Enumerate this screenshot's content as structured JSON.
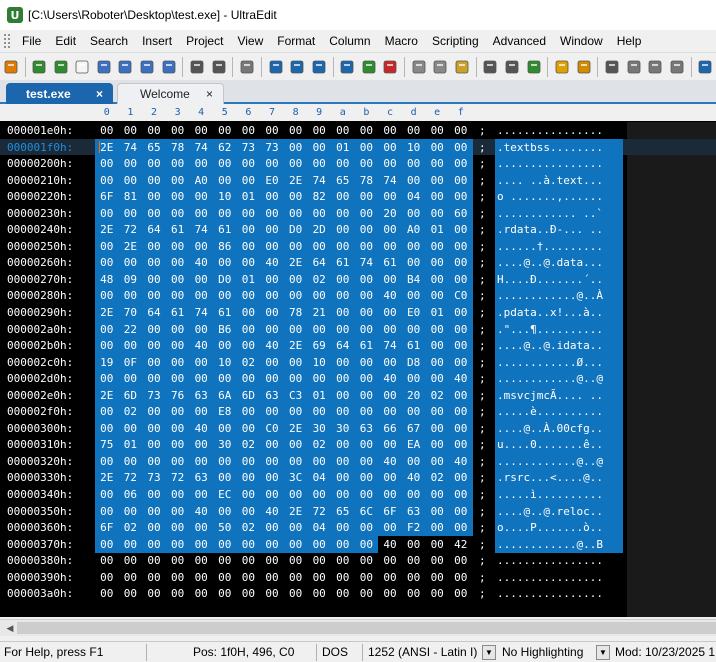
{
  "window": {
    "title": "[C:\\Users\\Roboter\\Desktop\\test.exe] - UltraEdit",
    "icon_letter": "U"
  },
  "menu": [
    "File",
    "Edit",
    "Search",
    "Insert",
    "Project",
    "View",
    "Format",
    "Column",
    "Macro",
    "Scripting",
    "Advanced",
    "Window",
    "Help"
  ],
  "toolbar_icons": [
    "open-file-icon",
    "back-icon",
    "forward-icon",
    "new-file-icon",
    "open-folder-icon",
    "folder-icon",
    "save-icon",
    "save-all-icon",
    "print-icon",
    "print-preview-icon",
    "page-icon",
    "hex-mode-icon",
    "column-mode-icon",
    "word-wrap-icon",
    "compare-icon",
    "check-icon",
    "stop-icon",
    "cut-icon",
    "copy-icon",
    "paste-icon",
    "find-icon",
    "replace-icon",
    "find-in-files-icon",
    "macro-icon",
    "list-icon",
    "bookmark-icon",
    "window-icon",
    "tile-icon",
    "cascade-icon",
    "web-icon"
  ],
  "tabs": [
    {
      "label": "test.exe",
      "close": "×",
      "active": true
    },
    {
      "label": "Welcome",
      "close": "×",
      "active": false
    }
  ],
  "hex_header": [
    "0",
    "1",
    "2",
    "3",
    "4",
    "5",
    "6",
    "7",
    "8",
    "9",
    "a",
    "b",
    "c",
    "d",
    "e",
    "f"
  ],
  "rows": [
    {
      "addr": "000001e0h:",
      "bytes": [
        "00",
        "00",
        "00",
        "00",
        "00",
        "00",
        "00",
        "00",
        "00",
        "00",
        "00",
        "00",
        "00",
        "00",
        "00",
        "00"
      ],
      "ascii": "................"
    },
    {
      "addr": "000001f0h:",
      "bytes": [
        "2E",
        "74",
        "65",
        "78",
        "74",
        "62",
        "73",
        "73",
        "00",
        "00",
        "01",
        "00",
        "00",
        "10",
        "00",
        "00"
      ],
      "ascii": ".textbss........"
    },
    {
      "addr": "00000200h:",
      "bytes": [
        "00",
        "00",
        "00",
        "00",
        "00",
        "00",
        "00",
        "00",
        "00",
        "00",
        "00",
        "00",
        "00",
        "00",
        "00",
        "00"
      ],
      "ascii": "................"
    },
    {
      "addr": "00000210h:",
      "bytes": [
        "00",
        "00",
        "00",
        "00",
        "A0",
        "00",
        "00",
        "E0",
        "2E",
        "74",
        "65",
        "78",
        "74",
        "00",
        "00",
        "00"
      ],
      "ascii": ".... ..à.text..."
    },
    {
      "addr": "00000220h:",
      "bytes": [
        "6F",
        "81",
        "00",
        "00",
        "00",
        "10",
        "01",
        "00",
        "00",
        "82",
        "00",
        "00",
        "00",
        "04",
        "00",
        "00"
      ],
      "ascii": "o .......‚......"
    },
    {
      "addr": "00000230h:",
      "bytes": [
        "00",
        "00",
        "00",
        "00",
        "00",
        "00",
        "00",
        "00",
        "00",
        "00",
        "00",
        "00",
        "20",
        "00",
        "00",
        "60"
      ],
      "ascii": "............ ..`"
    },
    {
      "addr": "00000240h:",
      "bytes": [
        "2E",
        "72",
        "64",
        "61",
        "74",
        "61",
        "00",
        "00",
        "D0",
        "2D",
        "00",
        "00",
        "00",
        "A0",
        "01",
        "00"
      ],
      "ascii": ".rdata..Ð-... .."
    },
    {
      "addr": "00000250h:",
      "bytes": [
        "00",
        "2E",
        "00",
        "00",
        "00",
        "86",
        "00",
        "00",
        "00",
        "00",
        "00",
        "00",
        "00",
        "00",
        "00",
        "00"
      ],
      "ascii": "......†........."
    },
    {
      "addr": "00000260h:",
      "bytes": [
        "00",
        "00",
        "00",
        "00",
        "40",
        "00",
        "00",
        "40",
        "2E",
        "64",
        "61",
        "74",
        "61",
        "00",
        "00",
        "00"
      ],
      "ascii": "....@..@.data..."
    },
    {
      "addr": "00000270h:",
      "bytes": [
        "48",
        "09",
        "00",
        "00",
        "00",
        "D0",
        "01",
        "00",
        "00",
        "02",
        "00",
        "00",
        "00",
        "B4",
        "00",
        "00"
      ],
      "ascii": "H....Ð.......´.."
    },
    {
      "addr": "00000280h:",
      "bytes": [
        "00",
        "00",
        "00",
        "00",
        "00",
        "00",
        "00",
        "00",
        "00",
        "00",
        "00",
        "00",
        "40",
        "00",
        "00",
        "C0"
      ],
      "ascii": "............@..À"
    },
    {
      "addr": "00000290h:",
      "bytes": [
        "2E",
        "70",
        "64",
        "61",
        "74",
        "61",
        "00",
        "00",
        "78",
        "21",
        "00",
        "00",
        "00",
        "E0",
        "01",
        "00"
      ],
      "ascii": ".pdata..x!...à.."
    },
    {
      "addr": "000002a0h:",
      "bytes": [
        "00",
        "22",
        "00",
        "00",
        "00",
        "B6",
        "00",
        "00",
        "00",
        "00",
        "00",
        "00",
        "00",
        "00",
        "00",
        "00"
      ],
      "ascii": ".\"...¶.........."
    },
    {
      "addr": "000002b0h:",
      "bytes": [
        "00",
        "00",
        "00",
        "00",
        "40",
        "00",
        "00",
        "40",
        "2E",
        "69",
        "64",
        "61",
        "74",
        "61",
        "00",
        "00"
      ],
      "ascii": "....@..@.idata.."
    },
    {
      "addr": "000002c0h:",
      "bytes": [
        "19",
        "0F",
        "00",
        "00",
        "00",
        "10",
        "02",
        "00",
        "00",
        "10",
        "00",
        "00",
        "00",
        "D8",
        "00",
        "00"
      ],
      "ascii": "............Ø..."
    },
    {
      "addr": "000002d0h:",
      "bytes": [
        "00",
        "00",
        "00",
        "00",
        "00",
        "00",
        "00",
        "00",
        "00",
        "00",
        "00",
        "00",
        "40",
        "00",
        "00",
        "40"
      ],
      "ascii": "............@..@"
    },
    {
      "addr": "000002e0h:",
      "bytes": [
        "2E",
        "6D",
        "73",
        "76",
        "63",
        "6A",
        "6D",
        "63",
        "C3",
        "01",
        "00",
        "00",
        "00",
        "20",
        "02",
        "00"
      ],
      "ascii": ".msvcjmcÃ.... .."
    },
    {
      "addr": "000002f0h:",
      "bytes": [
        "00",
        "02",
        "00",
        "00",
        "00",
        "E8",
        "00",
        "00",
        "00",
        "00",
        "00",
        "00",
        "00",
        "00",
        "00",
        "00"
      ],
      "ascii": ".....è.........."
    },
    {
      "addr": "00000300h:",
      "bytes": [
        "00",
        "00",
        "00",
        "00",
        "40",
        "00",
        "00",
        "C0",
        "2E",
        "30",
        "30",
        "63",
        "66",
        "67",
        "00",
        "00"
      ],
      "ascii": "....@..À.00cfg.."
    },
    {
      "addr": "00000310h:",
      "bytes": [
        "75",
        "01",
        "00",
        "00",
        "00",
        "30",
        "02",
        "00",
        "00",
        "02",
        "00",
        "00",
        "00",
        "EA",
        "00",
        "00"
      ],
      "ascii": "u....0.......ê.."
    },
    {
      "addr": "00000320h:",
      "bytes": [
        "00",
        "00",
        "00",
        "00",
        "00",
        "00",
        "00",
        "00",
        "00",
        "00",
        "00",
        "00",
        "40",
        "00",
        "00",
        "40"
      ],
      "ascii": "............@..@"
    },
    {
      "addr": "00000330h:",
      "bytes": [
        "2E",
        "72",
        "73",
        "72",
        "63",
        "00",
        "00",
        "00",
        "3C",
        "04",
        "00",
        "00",
        "00",
        "40",
        "02",
        "00"
      ],
      "ascii": ".rsrc...<....@.."
    },
    {
      "addr": "00000340h:",
      "bytes": [
        "00",
        "06",
        "00",
        "00",
        "00",
        "EC",
        "00",
        "00",
        "00",
        "00",
        "00",
        "00",
        "00",
        "00",
        "00",
        "00"
      ],
      "ascii": ".....ì.........."
    },
    {
      "addr": "00000350h:",
      "bytes": [
        "00",
        "00",
        "00",
        "00",
        "40",
        "00",
        "00",
        "40",
        "2E",
        "72",
        "65",
        "6C",
        "6F",
        "63",
        "00",
        "00"
      ],
      "ascii": "....@..@.reloc.."
    },
    {
      "addr": "00000360h:",
      "bytes": [
        "6F",
        "02",
        "00",
        "00",
        "00",
        "50",
        "02",
        "00",
        "00",
        "04",
        "00",
        "00",
        "00",
        "F2",
        "00",
        "00"
      ],
      "ascii": "o....P.......ò.."
    },
    {
      "addr": "00000370h:",
      "bytes": [
        "00",
        "00",
        "00",
        "00",
        "00",
        "00",
        "00",
        "00",
        "00",
        "00",
        "00",
        "00",
        "40",
        "00",
        "00",
        "42"
      ],
      "ascii": "............@..B"
    },
    {
      "addr": "00000380h:",
      "bytes": [
        "00",
        "00",
        "00",
        "00",
        "00",
        "00",
        "00",
        "00",
        "00",
        "00",
        "00",
        "00",
        "00",
        "00",
        "00",
        "00"
      ],
      "ascii": "................"
    },
    {
      "addr": "00000390h:",
      "bytes": [
        "00",
        "00",
        "00",
        "00",
        "00",
        "00",
        "00",
        "00",
        "00",
        "00",
        "00",
        "00",
        "00",
        "00",
        "00",
        "00"
      ],
      "ascii": "................"
    },
    {
      "addr": "000003a0h:",
      "bytes": [
        "00",
        "00",
        "00",
        "00",
        "00",
        "00",
        "00",
        "00",
        "00",
        "00",
        "00",
        "00",
        "00",
        "00",
        "00",
        "00"
      ],
      "ascii": "................"
    }
  ],
  "separator": ";",
  "status": {
    "help": "For Help, press F1",
    "position": "Pos: 1f0H, 496, C0",
    "line_ending": "DOS",
    "encoding": "1252  (ANSI - Latin I)",
    "highlighting": "No Highlighting",
    "modified": "Mod: 10/23/2025 1:"
  },
  "colors": {
    "selection": "#1073bd",
    "active_tab": "#1c66ad",
    "current_addr": "#1e8fe0",
    "cursor": "#ff6a00"
  }
}
